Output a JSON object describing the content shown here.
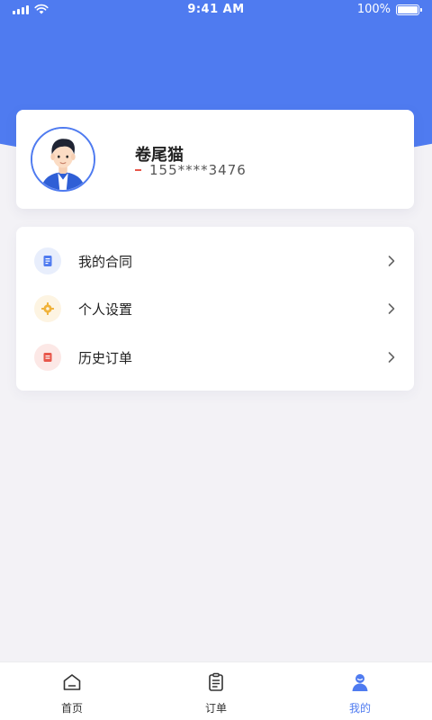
{
  "status_bar": {
    "time": "9:41 AM",
    "battery_text": "100%",
    "battery_level": 1.0
  },
  "profile": {
    "name": "卷尾猫",
    "phone": "155****3476",
    "avatar_icon": "user-avatar-icon"
  },
  "menu": {
    "items": [
      {
        "label": "我的合同",
        "icon": "contract-icon",
        "icon_color": "#4f7bf0",
        "icon_bg": "#e8eefc"
      },
      {
        "label": "个人设置",
        "icon": "settings-icon",
        "icon_color": "#f0b23a",
        "icon_bg": "#fdf4e2"
      },
      {
        "label": "历史订单",
        "icon": "order-history-icon",
        "icon_color": "#e8574b",
        "icon_bg": "#fce8e6"
      }
    ]
  },
  "tabs": [
    {
      "label": "首页",
      "icon": "home-icon",
      "active": false
    },
    {
      "label": "订单",
      "icon": "order-icon",
      "active": false
    },
    {
      "label": "我的",
      "icon": "profile-icon",
      "active": true
    }
  ],
  "colors": {
    "primary": "#4f7bf0",
    "background": "#f3f2f6",
    "accent_red": "#e8574b"
  }
}
